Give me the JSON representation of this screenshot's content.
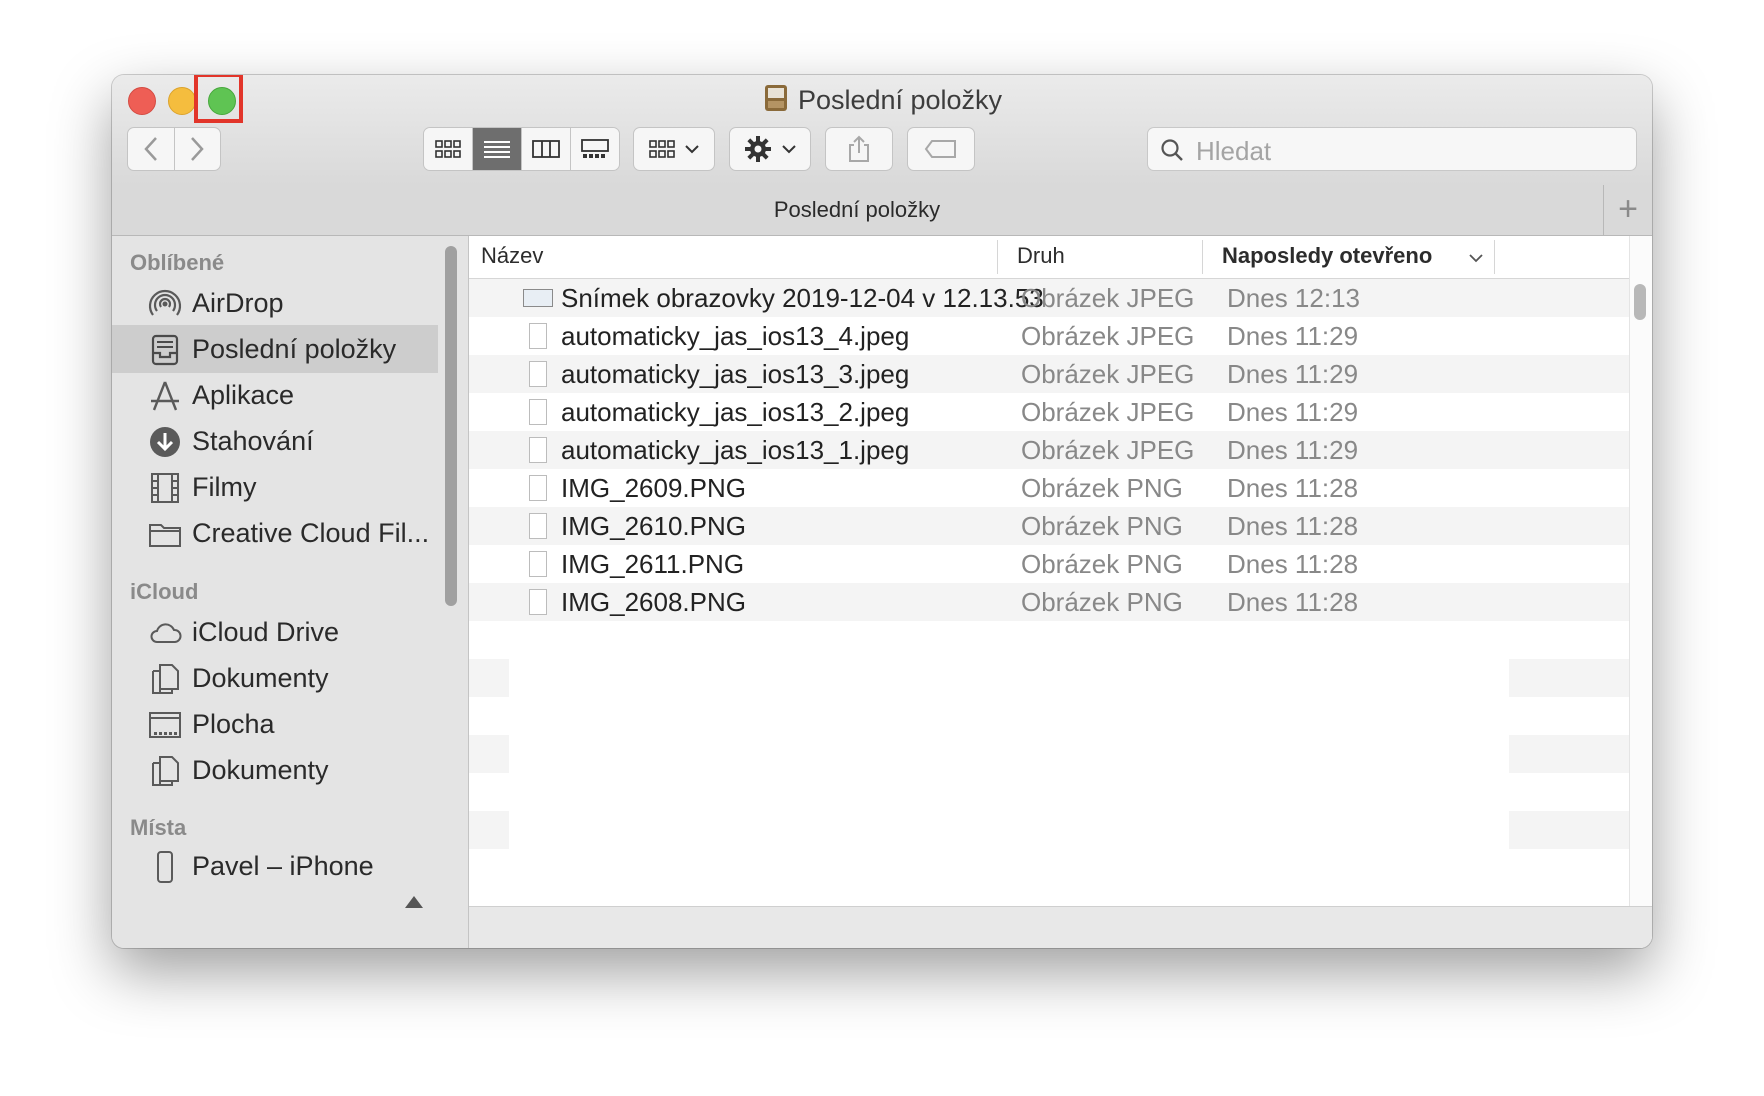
{
  "window": {
    "title": "Poslední položky",
    "tab_title": "Poslední položky"
  },
  "toolbar": {
    "back_icon": "chevron-left-icon",
    "forward_icon": "chevron-right-icon",
    "view_modes": [
      "icon-view",
      "list-view",
      "column-view",
      "gallery-view"
    ],
    "active_view": "list-view",
    "search_placeholder": "Hledat",
    "add_tab_label": "+"
  },
  "sidebar": {
    "sections": [
      {
        "title": "Oblíbené",
        "items": [
          {
            "label": "AirDrop",
            "icon": "airdrop-icon"
          },
          {
            "label": "Poslední položky",
            "icon": "recents-icon",
            "selected": true
          },
          {
            "label": "Aplikace",
            "icon": "applications-icon"
          },
          {
            "label": "Stahování",
            "icon": "downloads-icon"
          },
          {
            "label": "Filmy",
            "icon": "movies-icon"
          },
          {
            "label": "Creative Cloud Fil...",
            "icon": "folder-icon"
          }
        ]
      },
      {
        "title": "iCloud",
        "items": [
          {
            "label": "iCloud Drive",
            "icon": "cloud-icon"
          },
          {
            "label": "Dokumenty",
            "icon": "documents-icon"
          },
          {
            "label": "Plocha",
            "icon": "desktop-icon"
          },
          {
            "label": "Dokumenty",
            "icon": "documents-icon"
          }
        ]
      },
      {
        "title": "Místa",
        "items": [
          {
            "label": "Pavel – iPhone",
            "icon": "iphone-icon"
          }
        ]
      }
    ]
  },
  "file_list": {
    "columns": [
      "Název",
      "Druh",
      "Naposledy otevřeno"
    ],
    "rows": [
      {
        "name": "Snímek obrazovky 2019-12-04 v 12.13.53",
        "kind": "Obrázek JPEG",
        "date": "Dnes 12:13"
      },
      {
        "name": "automaticky_jas_ios13_4.jpeg",
        "kind": "Obrázek JPEG",
        "date": "Dnes 11:29"
      },
      {
        "name": "automaticky_jas_ios13_3.jpeg",
        "kind": "Obrázek JPEG",
        "date": "Dnes 11:29"
      },
      {
        "name": "automaticky_jas_ios13_2.jpeg",
        "kind": "Obrázek JPEG",
        "date": "Dnes 11:29"
      },
      {
        "name": "automaticky_jas_ios13_1.jpeg",
        "kind": "Obrázek JPEG",
        "date": "Dnes 11:29"
      },
      {
        "name": "IMG_2609.PNG",
        "kind": "Obrázek PNG",
        "date": "Dnes 11:28"
      },
      {
        "name": "IMG_2610.PNG",
        "kind": "Obrázek PNG",
        "date": "Dnes 11:28"
      },
      {
        "name": "IMG_2611.PNG",
        "kind": "Obrázek PNG",
        "date": "Dnes 11:28"
      },
      {
        "name": "IMG_2608.PNG",
        "kind": "Obrázek PNG",
        "date": "Dnes 11:28"
      }
    ]
  },
  "colors": {
    "close": "#ee5e55",
    "minimize": "#f5bd3e",
    "maximize": "#5fc453",
    "highlight": "#e2352a"
  }
}
